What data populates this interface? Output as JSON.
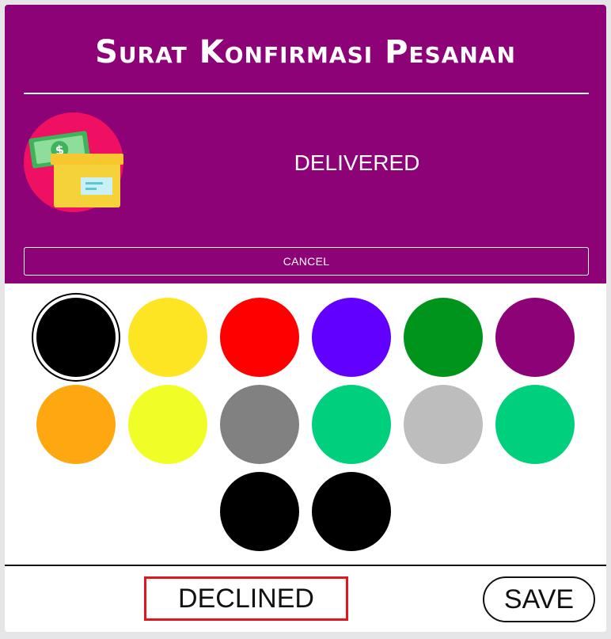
{
  "header": {
    "title": "Surat Konfirmasi Pesanan",
    "status": "DELIVERED",
    "icon": "money-package-icon",
    "cancel_label": "CANCEL",
    "background": "#8e0277"
  },
  "palette": {
    "selected_index": 0,
    "colors": [
      "#000000",
      "#fde523",
      "#ff0000",
      "#6100ff",
      "#00941d",
      "#8e0277",
      "#ffa710",
      "#f1fd27",
      "#818181",
      "#00d07e",
      "#bdbdbd",
      "#00d07e",
      "#000000",
      "#000000"
    ]
  },
  "footer": {
    "declined_label": "DECLINED",
    "save_label": "SAVE"
  }
}
